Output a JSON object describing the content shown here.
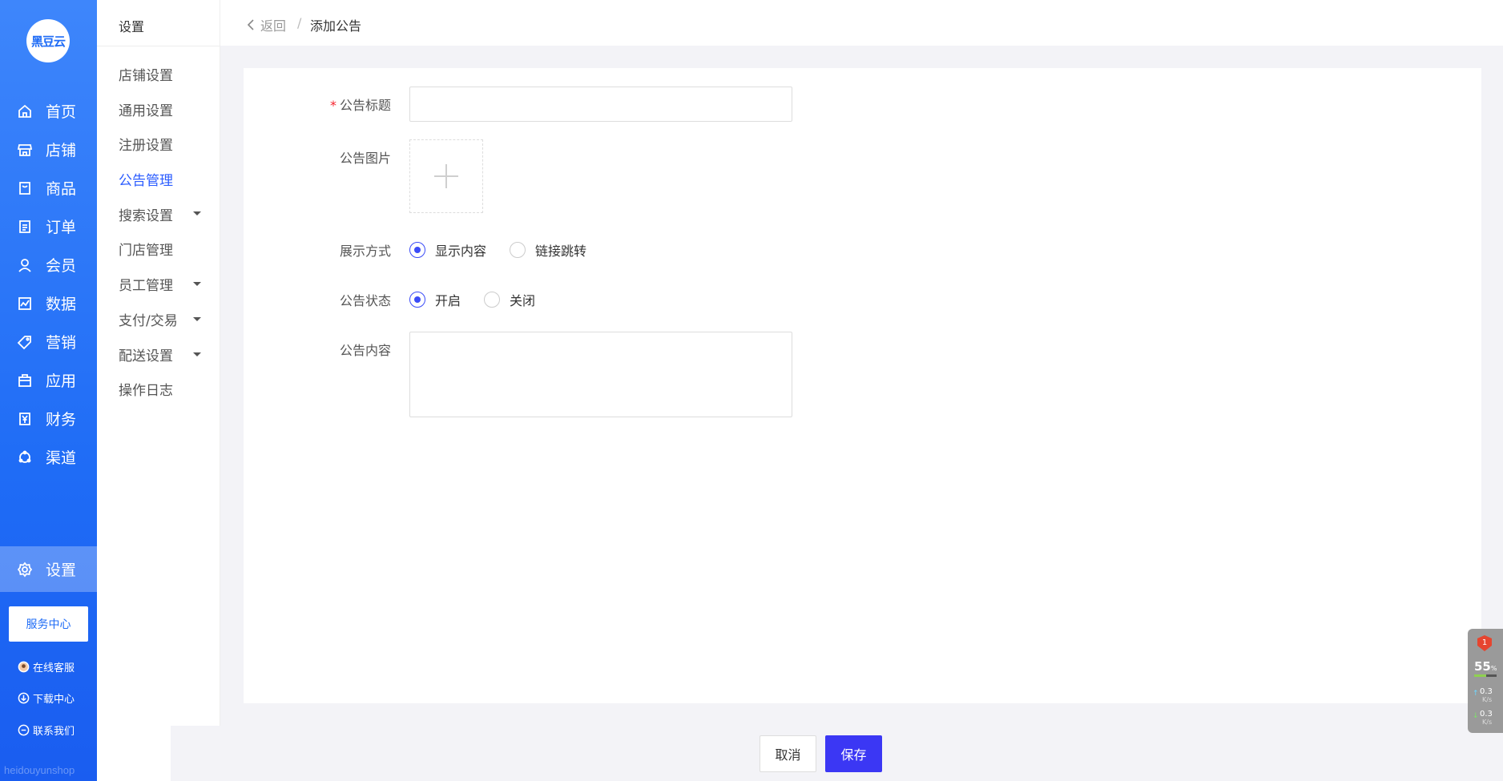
{
  "logo_text": "黑豆云",
  "nav_primary": [
    {
      "label": "首页",
      "icon": "home-icon"
    },
    {
      "label": "店铺",
      "icon": "store-icon"
    },
    {
      "label": "商品",
      "icon": "goods-icon"
    },
    {
      "label": "订单",
      "icon": "order-icon"
    },
    {
      "label": "会员",
      "icon": "member-icon"
    },
    {
      "label": "数据",
      "icon": "data-icon"
    },
    {
      "label": "营销",
      "icon": "tag-icon"
    },
    {
      "label": "应用",
      "icon": "app-icon"
    },
    {
      "label": "财务",
      "icon": "finance-icon"
    },
    {
      "label": "渠道",
      "icon": "channel-icon"
    },
    {
      "label": "设置",
      "icon": "gear-icon"
    }
  ],
  "service_center": "服务中心",
  "side_links": {
    "online_service": "在线客服",
    "download_center": "下载中心",
    "contact_us": "联系我们"
  },
  "watermark": "heidouyunshop",
  "settings_menu": {
    "title": "设置",
    "items": [
      {
        "label": "店铺设置"
      },
      {
        "label": "通用设置"
      },
      {
        "label": "注册设置"
      },
      {
        "label": "公告管理"
      },
      {
        "label": "搜索设置"
      },
      {
        "label": "门店管理"
      },
      {
        "label": "员工管理"
      },
      {
        "label": "支付/交易"
      },
      {
        "label": "配送设置"
      },
      {
        "label": "操作日志"
      }
    ]
  },
  "breadcrumb": {
    "back": "返回",
    "separator": "/",
    "current": "添加公告"
  },
  "form": {
    "title_label": "公告标题",
    "required_mark": "*",
    "title_value": "",
    "image_label": "公告图片",
    "display_label": "展示方式",
    "display_options": [
      "显示内容",
      "链接跳转"
    ],
    "status_label": "公告状态",
    "status_options": [
      "开启",
      "关闭"
    ],
    "content_label": "公告内容",
    "content_value": ""
  },
  "actions": {
    "cancel": "取消",
    "save": "保存"
  },
  "monitor": {
    "badge": "1",
    "percent": "55",
    "percent_unit": "%",
    "usage_fraction": 0.55,
    "upload": "0.3",
    "download": "0.3",
    "unit": "K/s"
  },
  "colors": {
    "primary_nav": "#1f6cf6",
    "accent": "#3b37f4",
    "active_menu": "#2b5cff",
    "required": "#f5222d"
  }
}
